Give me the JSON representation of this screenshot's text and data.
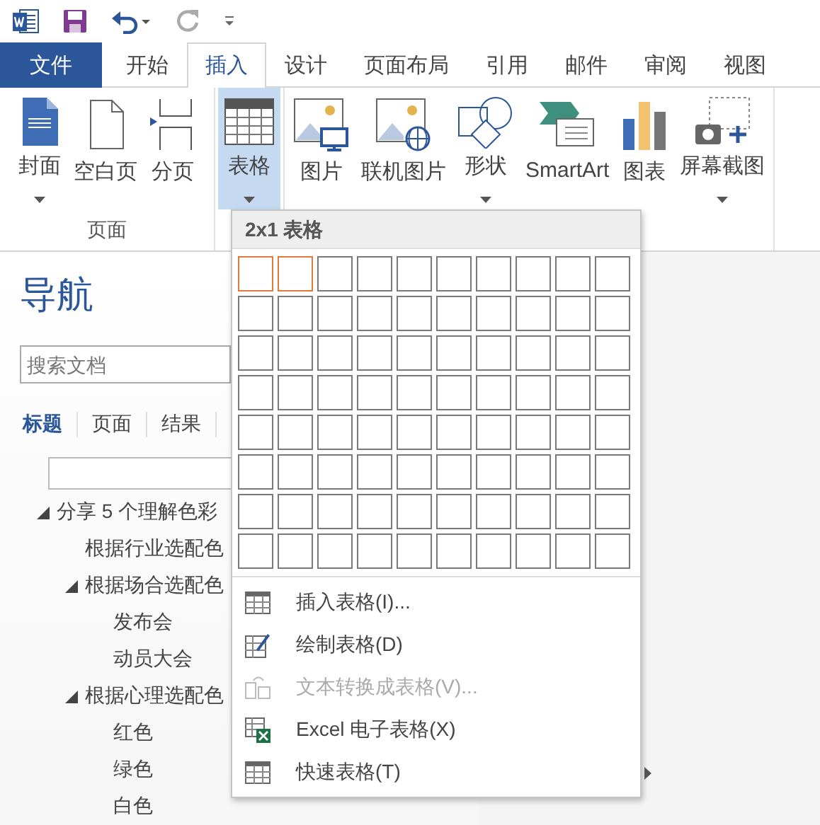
{
  "tabs": [
    {
      "label": "文件",
      "kind": "file",
      "selected": false
    },
    {
      "label": "开始",
      "kind": "tab",
      "selected": false
    },
    {
      "label": "插入",
      "kind": "tab",
      "selected": true
    },
    {
      "label": "设计",
      "kind": "tab",
      "selected": false
    },
    {
      "label": "页面布局",
      "kind": "tab",
      "selected": false
    },
    {
      "label": "引用",
      "kind": "tab",
      "selected": false
    },
    {
      "label": "邮件",
      "kind": "tab",
      "selected": false
    },
    {
      "label": "审阅",
      "kind": "tab",
      "selected": false
    },
    {
      "label": "视图",
      "kind": "tab",
      "selected": false
    }
  ],
  "ribbon": {
    "groups": [
      {
        "label": "页面",
        "buttons": [
          {
            "label": "封面",
            "dropdown": true,
            "selected": false
          },
          {
            "label": "空白页",
            "dropdown": false,
            "selected": false
          },
          {
            "label": "分页",
            "dropdown": false,
            "selected": false
          }
        ]
      },
      {
        "buttons": [
          {
            "label": "表格",
            "dropdown": true,
            "selected": true
          }
        ]
      },
      {
        "buttons": [
          {
            "label": "图片",
            "dropdown": false,
            "selected": false
          },
          {
            "label": "联机图片",
            "dropdown": false,
            "selected": false
          },
          {
            "label": "形状",
            "dropdown": true,
            "selected": false
          },
          {
            "label": "SmartArt",
            "dropdown": false,
            "selected": false
          },
          {
            "label": "图表",
            "dropdown": false,
            "selected": false
          },
          {
            "label": "屏幕截图",
            "dropdown": true,
            "selected": false
          }
        ]
      }
    ]
  },
  "navigation": {
    "title": "导航",
    "search": {
      "placeholder": "搜索文档"
    },
    "tabs": [
      {
        "label": "标题",
        "selected": true
      },
      {
        "label": "页面",
        "selected": false
      },
      {
        "label": "结果",
        "selected": false
      }
    ],
    "tree": [
      {
        "label": "分享 5 个理解色彩",
        "expanded": true,
        "children": [
          {
            "label": "根据行业选配色"
          },
          {
            "label": "根据场合选配色",
            "expanded": true,
            "children": [
              {
                "label": "发布会"
              },
              {
                "label": "动员大会"
              }
            ]
          },
          {
            "label": "根据心理选配色",
            "expanded": true,
            "children": [
              {
                "label": "红色"
              },
              {
                "label": "绿色"
              },
              {
                "label": "白色"
              }
            ]
          }
        ]
      }
    ]
  },
  "table_menu": {
    "header": "2x1 表格",
    "grid": [
      {
        "cells": [
          {
            "selected": true
          },
          {
            "selected": true
          },
          {
            "selected": false
          },
          {
            "selected": false
          },
          {
            "selected": false
          },
          {
            "selected": false
          },
          {
            "selected": false
          },
          {
            "selected": false
          },
          {
            "selected": false
          },
          {
            "selected": false
          }
        ]
      },
      {
        "cells": [
          {
            "selected": false
          },
          {
            "selected": false
          },
          {
            "selected": false
          },
          {
            "selected": false
          },
          {
            "selected": false
          },
          {
            "selected": false
          },
          {
            "selected": false
          },
          {
            "selected": false
          },
          {
            "selected": false
          },
          {
            "selected": false
          }
        ]
      },
      {
        "cells": [
          {
            "selected": false
          },
          {
            "selected": false
          },
          {
            "selected": false
          },
          {
            "selected": false
          },
          {
            "selected": false
          },
          {
            "selected": false
          },
          {
            "selected": false
          },
          {
            "selected": false
          },
          {
            "selected": false
          },
          {
            "selected": false
          }
        ]
      },
      {
        "cells": [
          {
            "selected": false
          },
          {
            "selected": false
          },
          {
            "selected": false
          },
          {
            "selected": false
          },
          {
            "selected": false
          },
          {
            "selected": false
          },
          {
            "selected": false
          },
          {
            "selected": false
          },
          {
            "selected": false
          },
          {
            "selected": false
          }
        ]
      },
      {
        "cells": [
          {
            "selected": false
          },
          {
            "selected": false
          },
          {
            "selected": false
          },
          {
            "selected": false
          },
          {
            "selected": false
          },
          {
            "selected": false
          },
          {
            "selected": false
          },
          {
            "selected": false
          },
          {
            "selected": false
          },
          {
            "selected": false
          }
        ]
      },
      {
        "cells": [
          {
            "selected": false
          },
          {
            "selected": false
          },
          {
            "selected": false
          },
          {
            "selected": false
          },
          {
            "selected": false
          },
          {
            "selected": false
          },
          {
            "selected": false
          },
          {
            "selected": false
          },
          {
            "selected": false
          },
          {
            "selected": false
          }
        ]
      },
      {
        "cells": [
          {
            "selected": false
          },
          {
            "selected": false
          },
          {
            "selected": false
          },
          {
            "selected": false
          },
          {
            "selected": false
          },
          {
            "selected": false
          },
          {
            "selected": false
          },
          {
            "selected": false
          },
          {
            "selected": false
          },
          {
            "selected": false
          }
        ]
      },
      {
        "cells": [
          {
            "selected": false
          },
          {
            "selected": false
          },
          {
            "selected": false
          },
          {
            "selected": false
          },
          {
            "selected": false
          },
          {
            "selected": false
          },
          {
            "selected": false
          },
          {
            "selected": false
          },
          {
            "selected": false
          },
          {
            "selected": false
          }
        ]
      }
    ],
    "items": [
      {
        "label": "插入表格(I)...",
        "disabled": false,
        "submenu": false
      },
      {
        "label": "绘制表格(D)",
        "disabled": false,
        "submenu": false
      },
      {
        "label": "文本转换成表格(V)...",
        "disabled": true,
        "submenu": false
      },
      {
        "label": "Excel 电子表格(X)",
        "disabled": false,
        "submenu": false
      },
      {
        "label": "快速表格(T)",
        "disabled": false,
        "submenu": true
      }
    ]
  }
}
